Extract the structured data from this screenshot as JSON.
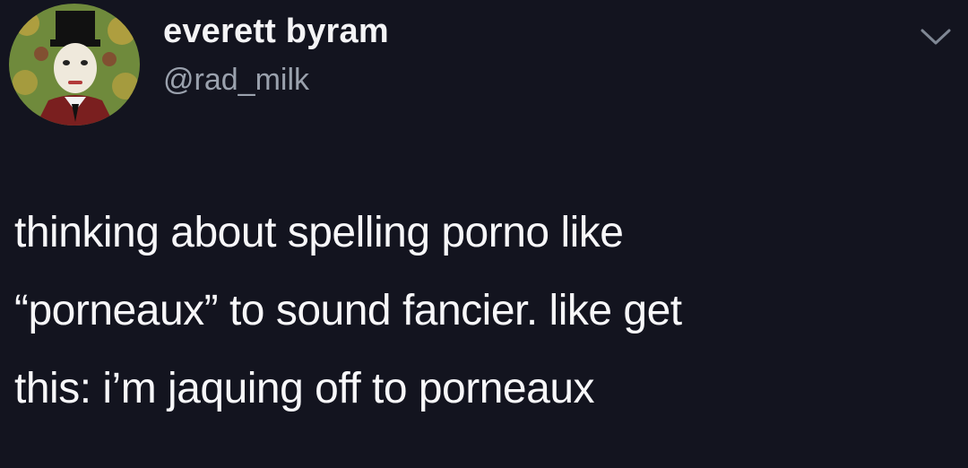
{
  "tweet": {
    "author": {
      "display_name": "everett byram",
      "handle": "@rad_milk",
      "avatar_icon": "avatar-illustration"
    },
    "menu_icon": "chevron-down-icon",
    "text": "thinking about spelling porno like\n“porneaux” to sound fancier. like get\nthis: i’m jaquing off to porneaux"
  },
  "colors": {
    "background": "#13141f",
    "primary_text": "#f7f7f9",
    "secondary_text": "#9aa1ad"
  }
}
